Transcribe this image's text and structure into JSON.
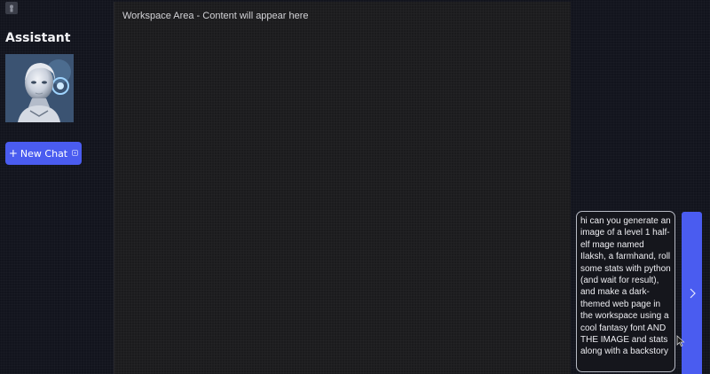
{
  "sidebar": {
    "title": "Assistant",
    "avatar_icon": "robot-avatar",
    "new_chat_label": "New Chat",
    "new_chat_plus": "+"
  },
  "workspace": {
    "placeholder": "Workspace Area - Content will appear here"
  },
  "chat": {
    "input_value": "hi can you generate an image of a level 1 half-elf mage named Ilaksh, a farmhand, roll some stats with python (and wait for result), and make a dark-themed web page in the workspace using a cool fantasy font AND THE IMAGE and stats along with a backstory",
    "send_icon": "chevron-right-icon"
  },
  "colors": {
    "accent": "#4a5cf0",
    "background": "#12141d",
    "workspace_bg": "#1b1b1d"
  }
}
